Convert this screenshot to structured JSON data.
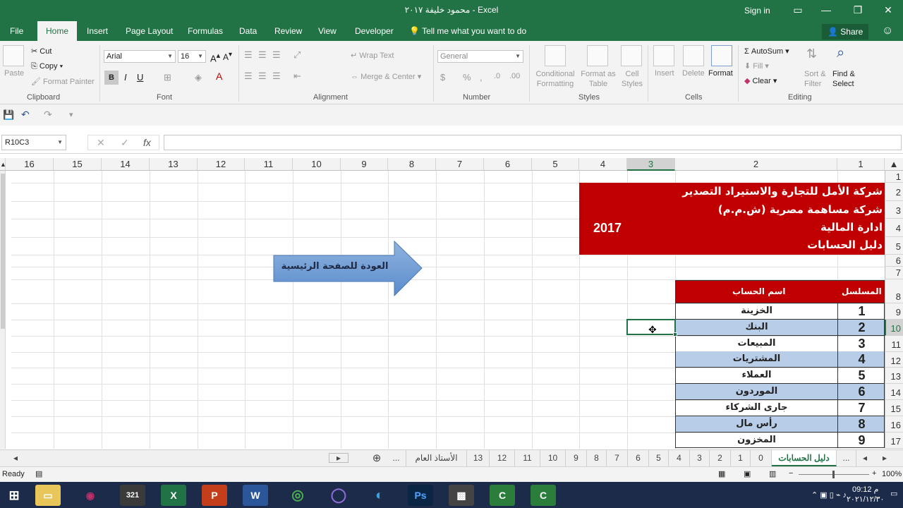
{
  "window": {
    "title": "محمود خليفة ٢٠١٧ - Excel",
    "signin": "Sign in"
  },
  "tabs": [
    "File",
    "Home",
    "Insert",
    "Page Layout",
    "Formulas",
    "Data",
    "Review",
    "View",
    "Developer"
  ],
  "tell_me": "Tell me what you want to do",
  "share_label": "Share",
  "ribbon": {
    "clipboard": {
      "label": "Clipboard",
      "paste": "Paste",
      "cut": "Cut",
      "copy": "Copy",
      "format_painter": "Format Painter"
    },
    "font": {
      "label": "Font",
      "name": "Arial",
      "size": "16",
      "bold": "B",
      "italic": "I",
      "underline": "U"
    },
    "alignment": {
      "label": "Alignment",
      "wrap": "Wrap Text",
      "merge": "Merge & Center"
    },
    "number": {
      "label": "Number",
      "format": "General"
    },
    "styles": {
      "label": "Styles",
      "conditional": "Conditional Formatting",
      "format_table": "Format as Table",
      "cell_styles": "Cell Styles"
    },
    "cells": {
      "label": "Cells",
      "insert": "Insert",
      "delete": "Delete",
      "format": "Format"
    },
    "editing": {
      "label": "Editing",
      "autosum": "AutoSum",
      "fill": "Fill",
      "clear": "Clear",
      "sort": "Sort & Filter",
      "find": "Find & Select"
    }
  },
  "formula_bar": {
    "name_box": "R10C3",
    "fx": "fx",
    "cancel": "✕",
    "enter": "✓",
    "value": ""
  },
  "columns": [
    "16",
    "15",
    "14",
    "13",
    "12",
    "11",
    "10",
    "9",
    "8",
    "7",
    "6",
    "5",
    "4",
    "3",
    "2",
    "1"
  ],
  "rows": [
    "1",
    "2",
    "3",
    "4",
    "5",
    "6",
    "7",
    "8",
    "9",
    "10",
    "11",
    "12",
    "13",
    "14",
    "15",
    "16",
    "17"
  ],
  "banner": {
    "line1": "شركة الأمل للتجارة والاستيراد التصدير",
    "line2": "شركة مساهمة مصرية (ش.م.م)",
    "line3": "ادارة المالية",
    "line4": "دليل الحسابات",
    "year": "2017"
  },
  "back_button": "العودة للصفحة الرئيسية",
  "table": {
    "header_name": "اسم الحساب",
    "header_num": "المسلسل",
    "rows": [
      {
        "num": "1",
        "name": "الخزينة"
      },
      {
        "num": "2",
        "name": "البنك"
      },
      {
        "num": "3",
        "name": "المبيعات"
      },
      {
        "num": "4",
        "name": "المشتريات"
      },
      {
        "num": "5",
        "name": "العملاء"
      },
      {
        "num": "6",
        "name": "الموردون"
      },
      {
        "num": "7",
        "name": "جارى الشركاء"
      },
      {
        "num": "8",
        "name": "رأس مال"
      },
      {
        "num": "9",
        "name": "المخزون"
      }
    ]
  },
  "sheets": [
    "...",
    "دليل الحسابات",
    "0",
    "1",
    "2",
    "3",
    "4",
    "5",
    "6",
    "7",
    "8",
    "9",
    "10",
    "11",
    "12",
    "13",
    "الأستاذ العام",
    "..."
  ],
  "active_sheet": "دليل الحسابات",
  "status": {
    "ready": "Ready",
    "zoom": "100%"
  },
  "clock": {
    "time": "09:12 م",
    "date": "٢٠٢١/١٢/٣٠"
  }
}
